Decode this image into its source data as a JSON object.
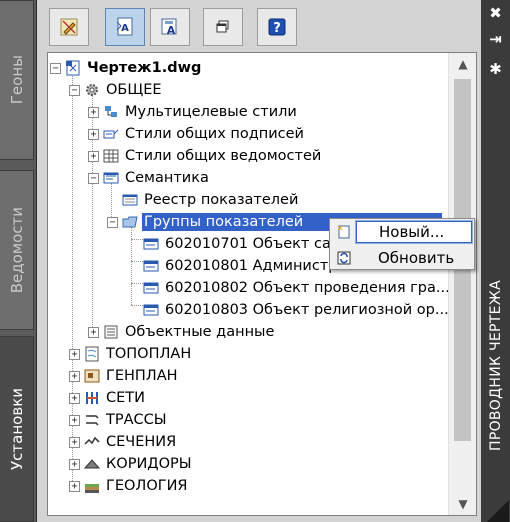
{
  "left_tabs": [
    {
      "label": "Геоны"
    },
    {
      "label": "Ведомости"
    },
    {
      "label": "Установки"
    }
  ],
  "right_strip": {
    "title": "ПРОВОДНИК ЧЕРТЕЖА",
    "close_glyph": "✖",
    "pin_glyph": "⇥",
    "props_glyph": "✱"
  },
  "toolbar": {
    "buttons": [
      {
        "icon": "edit-pencil-icon",
        "active": false
      },
      {
        "icon": "display-text-icon",
        "active": true
      },
      {
        "icon": "text-style-icon",
        "active": false
      },
      {
        "icon": "windows-icon",
        "active": false
      },
      {
        "icon": "help-icon",
        "active": false,
        "glyph": "?"
      }
    ]
  },
  "tree": {
    "root": {
      "label": "Чертеж1.dwg",
      "icon": "drawing-file-icon"
    },
    "obshchee": {
      "label": "ОБЩЕЕ",
      "icon": "gear-icon"
    },
    "multileader": {
      "label": "Мультицелевые стили",
      "icon": "multileader-style-icon"
    },
    "labels": {
      "label": "Стили общих подписей",
      "icon": "label-style-icon"
    },
    "tables": {
      "label": "Стили общих ведомостей",
      "icon": "table-style-icon"
    },
    "semantika": {
      "label": "Семантика",
      "icon": "semantics-icon"
    },
    "registry": {
      "label": "Реестр показателей",
      "icon": "registry-icon"
    },
    "groups": {
      "label": "Группы показателей",
      "icon": "folder-icon"
    },
    "groups_children": [
      {
        "label": "602010701 Объект санитарно"
      },
      {
        "label": "602010801 Административн"
      },
      {
        "label": "602010802 Объект проведения гра..."
      },
      {
        "label": "602010803 Объект религиозной ор..."
      }
    ],
    "object_data": {
      "label": "Объектные данные",
      "icon": "object-data-icon"
    },
    "sections": [
      {
        "label": "ТОПОПЛАН",
        "icon": "topoplan-icon"
      },
      {
        "label": "ГЕНПЛАН",
        "icon": "genplan-icon"
      },
      {
        "label": "СЕТИ",
        "icon": "networks-icon"
      },
      {
        "label": "ТРАССЫ",
        "icon": "routes-icon"
      },
      {
        "label": "СЕЧЕНИЯ",
        "icon": "sections-icon"
      },
      {
        "label": "КОРИДОРЫ",
        "icon": "corridors-icon"
      },
      {
        "label": "ГЕОЛОГИЯ",
        "icon": "geology-icon"
      }
    ],
    "collapse_glyph": "−",
    "expand_glyph": "+"
  },
  "context_menu": {
    "items": [
      {
        "label": "Новый...",
        "icon": "new-icon",
        "highlighted": true
      },
      {
        "label": "Обновить",
        "icon": "refresh-icon",
        "highlighted": false
      }
    ]
  },
  "colors": {
    "selection": "#3261c8",
    "panel_bg": "#d4d4d4",
    "title_strip": "#3b3b3b"
  }
}
